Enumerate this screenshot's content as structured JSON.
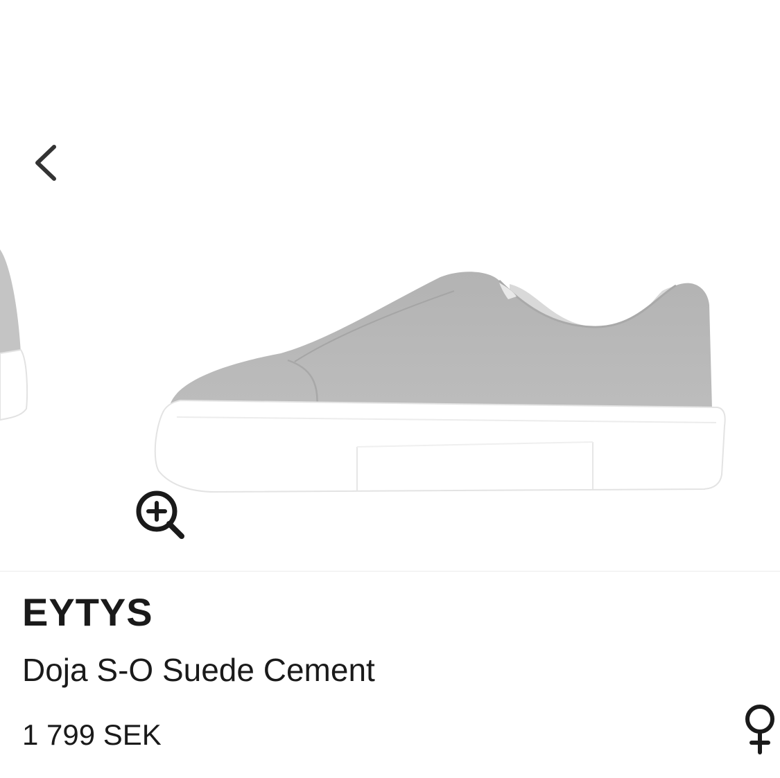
{
  "gallery": {
    "prev_icon": "chevron-left-icon",
    "zoom_icon": "zoom-in-icon",
    "product_image_alt": "grey suede slip-on sneaker with white sole"
  },
  "product": {
    "brand": "EYTYS",
    "name": "Doja S-O Suede Cement",
    "price": "1 799 SEK",
    "gender_icon": "female-symbol-icon"
  },
  "colors": {
    "suede": "#b9b9b9",
    "sole": "#ffffff",
    "text": "#1a1a1a"
  }
}
